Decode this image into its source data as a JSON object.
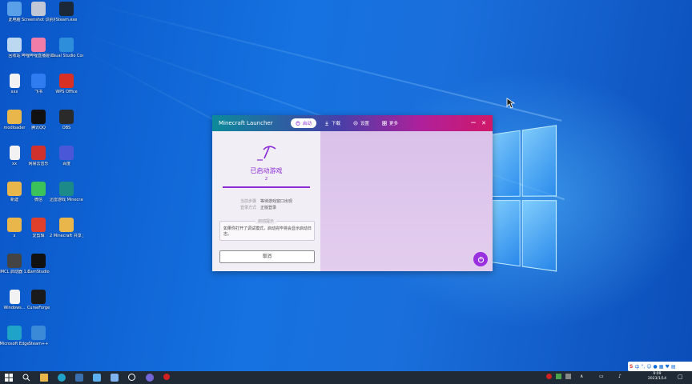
{
  "desktop": {
    "icons": [
      {
        "label": "此电脑",
        "icon": "computer-icon"
      },
      {
        "label": "Screenshot 识别系统",
        "icon": "app-icon"
      },
      {
        "label": "Steam.exe",
        "icon": "steam-icon"
      },
      {
        "label": "回收站",
        "icon": "recycle-bin-icon"
      },
      {
        "label": "哔哩哔哩直播姬 工具",
        "icon": "bilibili-icon"
      },
      {
        "label": "Visual Studio Code",
        "icon": "vscode-icon"
      },
      {
        "label": "xxx",
        "icon": "document-icon"
      },
      {
        "label": "飞书",
        "icon": "feishu-icon"
      },
      {
        "label": "WPS Office",
        "icon": "wps-icon"
      },
      {
        "label": "modloader",
        "icon": "folder-icon"
      },
      {
        "label": "腾讯QQ",
        "icon": "qq-icon"
      },
      {
        "label": "OBS",
        "icon": "obs-icon"
      },
      {
        "label": "xx",
        "icon": "document-icon"
      },
      {
        "label": "网易云音乐",
        "icon": "netease-music-icon"
      },
      {
        "label": "百度",
        "icon": "baidu-icon"
      },
      {
        "label": "新建",
        "icon": "folder-icon"
      },
      {
        "label": "微信",
        "icon": "wechat-icon"
      },
      {
        "label": "迅雷游戏 Minecraft",
        "icon": "minecraft-launcher-icon"
      },
      {
        "label": "x",
        "icon": "folder-icon"
      },
      {
        "label": "爱剪辑",
        "icon": "editor-icon"
      },
      {
        "label": "2 Minecraft 共享 Java",
        "icon": "folder-icon"
      },
      {
        "label": "HMCL 启动器 1.8 Java",
        "icon": "hmcl-icon"
      },
      {
        "label": "CamStudio",
        "icon": "record-icon"
      },
      {
        "label": "Windows...",
        "icon": "document-icon"
      },
      {
        "label": "CurseForge",
        "icon": "curseforge-icon"
      },
      {
        "label": "Microsoft Edge",
        "icon": "edge-icon"
      },
      {
        "label": "Steam++",
        "icon": "steampp-icon"
      }
    ]
  },
  "launcher": {
    "title": "Minecraft Launcher",
    "tabs": [
      {
        "label": "启动",
        "icon": "power-icon",
        "active": true
      },
      {
        "label": "下载",
        "icon": "download-icon",
        "active": false
      },
      {
        "label": "设置",
        "icon": "settings-icon",
        "active": false
      },
      {
        "label": "更多",
        "icon": "grid-icon",
        "active": false
      }
    ],
    "minimize": "−",
    "close": "✕",
    "status": "已启动游戏",
    "count": "2",
    "progress": 1.0,
    "rows": [
      {
        "key": "当前步骤",
        "value": "等待游戏窗口出现"
      },
      {
        "key": "登录方式",
        "value": "正版登录"
      }
    ],
    "tip_caption": "启动提示",
    "tip_text": "如果你打开了调试模式，启动完毕将会显示启动日志。",
    "cancel_label": "取消",
    "accent": "#8a2bd6"
  },
  "taskbar": {
    "time": "9:09",
    "date": "2023/1/14",
    "ime_label": "中"
  }
}
